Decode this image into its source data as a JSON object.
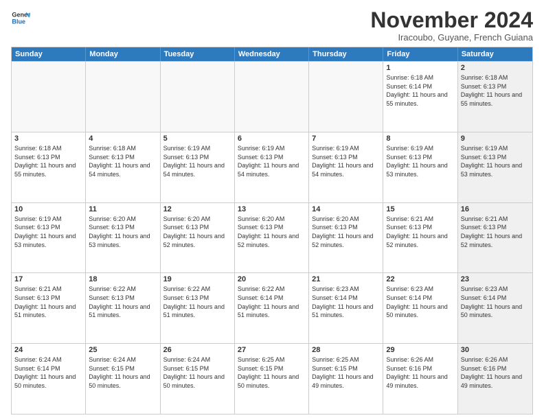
{
  "logo": {
    "line1": "General",
    "line2": "Blue"
  },
  "header": {
    "month": "November 2024",
    "location": "Iracoubo, Guyane, French Guiana"
  },
  "weekdays": [
    "Sunday",
    "Monday",
    "Tuesday",
    "Wednesday",
    "Thursday",
    "Friday",
    "Saturday"
  ],
  "rows": [
    [
      {
        "day": "",
        "text": "",
        "empty": true
      },
      {
        "day": "",
        "text": "",
        "empty": true
      },
      {
        "day": "",
        "text": "",
        "empty": true
      },
      {
        "day": "",
        "text": "",
        "empty": true
      },
      {
        "day": "",
        "text": "",
        "empty": true
      },
      {
        "day": "1",
        "text": "Sunrise: 6:18 AM\nSunset: 6:14 PM\nDaylight: 11 hours and 55 minutes.",
        "shaded": false
      },
      {
        "day": "2",
        "text": "Sunrise: 6:18 AM\nSunset: 6:13 PM\nDaylight: 11 hours and 55 minutes.",
        "shaded": true
      }
    ],
    [
      {
        "day": "3",
        "text": "Sunrise: 6:18 AM\nSunset: 6:13 PM\nDaylight: 11 hours and 55 minutes.",
        "shaded": false
      },
      {
        "day": "4",
        "text": "Sunrise: 6:18 AM\nSunset: 6:13 PM\nDaylight: 11 hours and 54 minutes.",
        "shaded": false
      },
      {
        "day": "5",
        "text": "Sunrise: 6:19 AM\nSunset: 6:13 PM\nDaylight: 11 hours and 54 minutes.",
        "shaded": false
      },
      {
        "day": "6",
        "text": "Sunrise: 6:19 AM\nSunset: 6:13 PM\nDaylight: 11 hours and 54 minutes.",
        "shaded": false
      },
      {
        "day": "7",
        "text": "Sunrise: 6:19 AM\nSunset: 6:13 PM\nDaylight: 11 hours and 54 minutes.",
        "shaded": false
      },
      {
        "day": "8",
        "text": "Sunrise: 6:19 AM\nSunset: 6:13 PM\nDaylight: 11 hours and 53 minutes.",
        "shaded": false
      },
      {
        "day": "9",
        "text": "Sunrise: 6:19 AM\nSunset: 6:13 PM\nDaylight: 11 hours and 53 minutes.",
        "shaded": true
      }
    ],
    [
      {
        "day": "10",
        "text": "Sunrise: 6:19 AM\nSunset: 6:13 PM\nDaylight: 11 hours and 53 minutes.",
        "shaded": false
      },
      {
        "day": "11",
        "text": "Sunrise: 6:20 AM\nSunset: 6:13 PM\nDaylight: 11 hours and 53 minutes.",
        "shaded": false
      },
      {
        "day": "12",
        "text": "Sunrise: 6:20 AM\nSunset: 6:13 PM\nDaylight: 11 hours and 52 minutes.",
        "shaded": false
      },
      {
        "day": "13",
        "text": "Sunrise: 6:20 AM\nSunset: 6:13 PM\nDaylight: 11 hours and 52 minutes.",
        "shaded": false
      },
      {
        "day": "14",
        "text": "Sunrise: 6:20 AM\nSunset: 6:13 PM\nDaylight: 11 hours and 52 minutes.",
        "shaded": false
      },
      {
        "day": "15",
        "text": "Sunrise: 6:21 AM\nSunset: 6:13 PM\nDaylight: 11 hours and 52 minutes.",
        "shaded": false
      },
      {
        "day": "16",
        "text": "Sunrise: 6:21 AM\nSunset: 6:13 PM\nDaylight: 11 hours and 52 minutes.",
        "shaded": true
      }
    ],
    [
      {
        "day": "17",
        "text": "Sunrise: 6:21 AM\nSunset: 6:13 PM\nDaylight: 11 hours and 51 minutes.",
        "shaded": false
      },
      {
        "day": "18",
        "text": "Sunrise: 6:22 AM\nSunset: 6:13 PM\nDaylight: 11 hours and 51 minutes.",
        "shaded": false
      },
      {
        "day": "19",
        "text": "Sunrise: 6:22 AM\nSunset: 6:13 PM\nDaylight: 11 hours and 51 minutes.",
        "shaded": false
      },
      {
        "day": "20",
        "text": "Sunrise: 6:22 AM\nSunset: 6:14 PM\nDaylight: 11 hours and 51 minutes.",
        "shaded": false
      },
      {
        "day": "21",
        "text": "Sunrise: 6:23 AM\nSunset: 6:14 PM\nDaylight: 11 hours and 51 minutes.",
        "shaded": false
      },
      {
        "day": "22",
        "text": "Sunrise: 6:23 AM\nSunset: 6:14 PM\nDaylight: 11 hours and 50 minutes.",
        "shaded": false
      },
      {
        "day": "23",
        "text": "Sunrise: 6:23 AM\nSunset: 6:14 PM\nDaylight: 11 hours and 50 minutes.",
        "shaded": true
      }
    ],
    [
      {
        "day": "24",
        "text": "Sunrise: 6:24 AM\nSunset: 6:14 PM\nDaylight: 11 hours and 50 minutes.",
        "shaded": false
      },
      {
        "day": "25",
        "text": "Sunrise: 6:24 AM\nSunset: 6:15 PM\nDaylight: 11 hours and 50 minutes.",
        "shaded": false
      },
      {
        "day": "26",
        "text": "Sunrise: 6:24 AM\nSunset: 6:15 PM\nDaylight: 11 hours and 50 minutes.",
        "shaded": false
      },
      {
        "day": "27",
        "text": "Sunrise: 6:25 AM\nSunset: 6:15 PM\nDaylight: 11 hours and 50 minutes.",
        "shaded": false
      },
      {
        "day": "28",
        "text": "Sunrise: 6:25 AM\nSunset: 6:15 PM\nDaylight: 11 hours and 49 minutes.",
        "shaded": false
      },
      {
        "day": "29",
        "text": "Sunrise: 6:26 AM\nSunset: 6:16 PM\nDaylight: 11 hours and 49 minutes.",
        "shaded": false
      },
      {
        "day": "30",
        "text": "Sunrise: 6:26 AM\nSunset: 6:16 PM\nDaylight: 11 hours and 49 minutes.",
        "shaded": true
      }
    ]
  ]
}
